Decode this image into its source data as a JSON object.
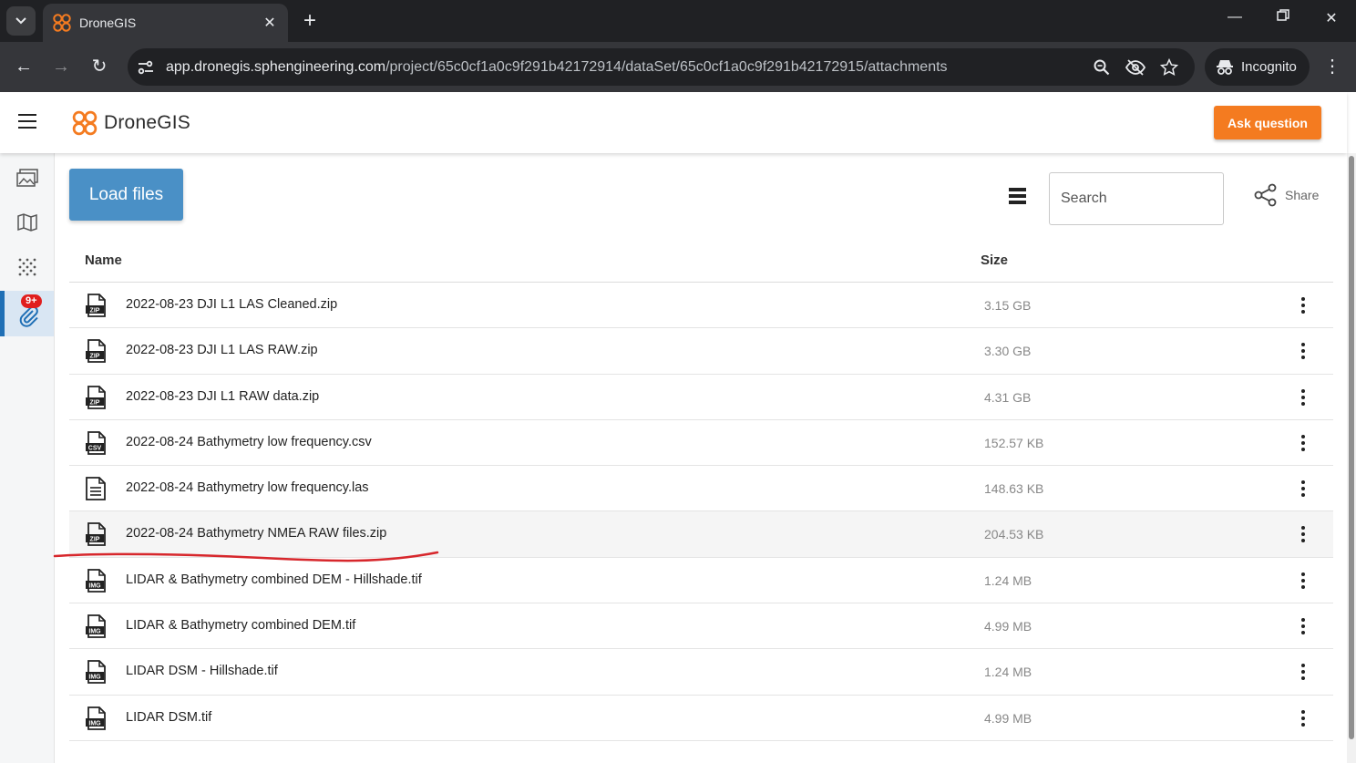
{
  "browser": {
    "tab_title": "DroneGIS",
    "url_host": "app.dronegis.sphengineering.com",
    "url_path": "/project/65c0cf1a0c9f291b42172914/dataSet/65c0cf1a0c9f291b42172915/attachments",
    "incognito_label": "Incognito"
  },
  "header": {
    "logo_text": "DroneGIS",
    "ask_label": "Ask question",
    "accent": "#f47b20"
  },
  "rail": {
    "badge": "9+",
    "items": [
      "gallery-icon",
      "map-icon",
      "pointcloud-icon",
      "attachments-icon"
    ]
  },
  "toolbar": {
    "load_label": "Load files",
    "search_placeholder": "Search",
    "share_label": "Share"
  },
  "table": {
    "col_name": "Name",
    "col_size": "Size",
    "rows": [
      {
        "name": "2022-08-23 DJI L1 LAS Cleaned.zip",
        "size": "3.15 GB",
        "type": "ZIP"
      },
      {
        "name": "2022-08-23 DJI L1 LAS RAW.zip",
        "size": "3.30 GB",
        "type": "ZIP"
      },
      {
        "name": "2022-08-23 DJI L1 RAW data.zip",
        "size": "4.31 GB",
        "type": "ZIP"
      },
      {
        "name": "2022-08-24 Bathymetry low frequency.csv",
        "size": "152.57 KB",
        "type": "CSV"
      },
      {
        "name": "2022-08-24 Bathymetry low frequency.las",
        "size": "148.63 KB",
        "type": "DOC"
      },
      {
        "name": "2022-08-24 Bathymetry NMEA RAW files.zip",
        "size": "204.53 KB",
        "type": "ZIP"
      },
      {
        "name": "LIDAR & Bathymetry combined DEM - Hillshade.tif",
        "size": "1.24 MB",
        "type": "IMG"
      },
      {
        "name": "LIDAR & Bathymetry combined DEM.tif",
        "size": "4.99 MB",
        "type": "IMG"
      },
      {
        "name": "LIDAR DSM - Hillshade.tif",
        "size": "1.24 MB",
        "type": "IMG"
      },
      {
        "name": "LIDAR DSM.tif",
        "size": "4.99 MB",
        "type": "IMG"
      }
    ]
  }
}
